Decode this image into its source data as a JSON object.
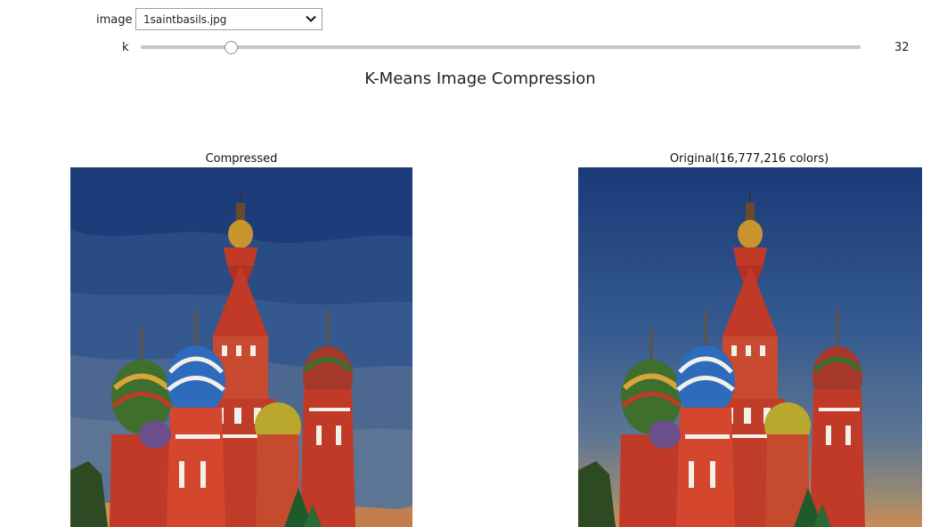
{
  "controls": {
    "image_label": "image",
    "image_value": "1saintbasils.jpg",
    "k_label": "k",
    "k_value": "32",
    "k_min": 1,
    "k_max": 256,
    "k_fraction": 0.126
  },
  "figure": {
    "title": "K-Means Image Compression",
    "left_title": "Compressed",
    "right_title": "Original(16,777,216 colors)"
  },
  "colors": {
    "sky_top": "#1d3d7a",
    "sky_mid": "#35598f",
    "sky_low": "#5d7595",
    "sunset": "#d08a55",
    "red": "#c13a27",
    "white": "#f3f0ea",
    "gold": "#c8942d",
    "blue_dome": "#2e6bbd",
    "green": "#3e6f2c",
    "yellow_dome": "#b9a72e"
  },
  "icons": {
    "dropdown": "chevron-down-icon"
  }
}
